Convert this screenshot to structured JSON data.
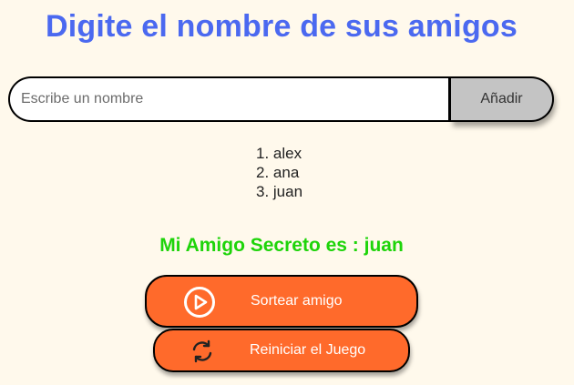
{
  "header": {
    "title": "Digite el nombre de sus amigos"
  },
  "input": {
    "placeholder": "Escribe un nombre",
    "value": "",
    "add_label": "Añadir"
  },
  "friends": [
    "alex",
    "ana",
    "juan"
  ],
  "result": {
    "text": "Mi Amigo Secreto es : juan"
  },
  "actions": {
    "draw_label": "Sortear amigo",
    "draw_icon": "play-circle-icon",
    "reset_label": "Reiniciar el Juego",
    "reset_icon": "refresh-icon"
  },
  "colors": {
    "background": "#fff9ec",
    "title": "#4b69f0",
    "result": "#1ed40a",
    "button": "#ff6a2b",
    "add_button": "#c4c4c4"
  }
}
